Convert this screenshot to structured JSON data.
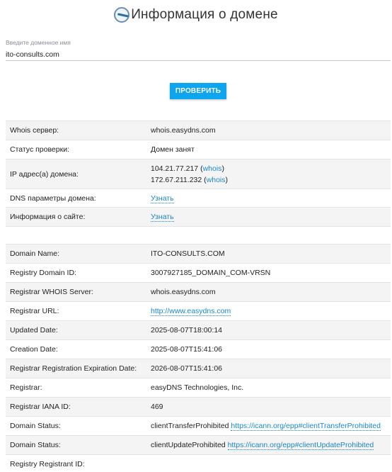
{
  "header": {
    "title": "Информация о домене"
  },
  "search": {
    "label": "Введите доменное имя",
    "value": "ito-consults.com"
  },
  "check_button": "ПРОВЕРИТЬ",
  "summary": {
    "whois_server": {
      "label": "Whois сервер:",
      "value": "whois.easydns.com"
    },
    "status": {
      "label": "Статус проверки:",
      "value": "Домен занят"
    },
    "ip": {
      "label": "IP адрес(а) домена:",
      "addresses": [
        {
          "ip": "104.21.77.217",
          "link": "whois"
        },
        {
          "ip": "172.67.211.232",
          "link": "whois"
        }
      ]
    },
    "dns": {
      "label": "DNS параметры домена:",
      "link": "Узнать"
    },
    "site": {
      "label": "Информация о сайте:",
      "link": "Узнать"
    }
  },
  "whois": {
    "domain_name": {
      "label": "Domain Name:",
      "value": "ITO-CONSULTS.COM"
    },
    "registry_domain_id": {
      "label": "Registry Domain ID:",
      "value": "3007927185_DOMAIN_COM-VRSN"
    },
    "registrar_whois_server": {
      "label": "Registrar WHOIS Server:",
      "value": "whois.easydns.com"
    },
    "registrar_url": {
      "label": "Registrar URL:",
      "value": "http://www.easydns.com"
    },
    "updated_date": {
      "label": "Updated Date:",
      "value": "2025-08-07T18:00:14"
    },
    "creation_date": {
      "label": "Creation Date:",
      "value": "2025-08-07T15:41:06"
    },
    "expiration_date": {
      "label": "Registrar Registration Expiration Date:",
      "value": "2026-08-07T15:41:06"
    },
    "registrar": {
      "label": "Registrar:",
      "value": "easyDNS Technologies, Inc."
    },
    "iana_id": {
      "label": "Registrar IANA ID:",
      "value": "469"
    },
    "status1": {
      "label": "Domain Status:",
      "value": "clientTransferProhibited",
      "link": "https://icann.org/epp#clientTransferProhibited"
    },
    "status2": {
      "label": "Domain Status:",
      "value": "clientUpdateProhibited",
      "link": "https://icann.org/epp#clientUpdateProhibited"
    },
    "registrant_id": {
      "label": "Registry Registrant ID:",
      "value": ""
    }
  }
}
